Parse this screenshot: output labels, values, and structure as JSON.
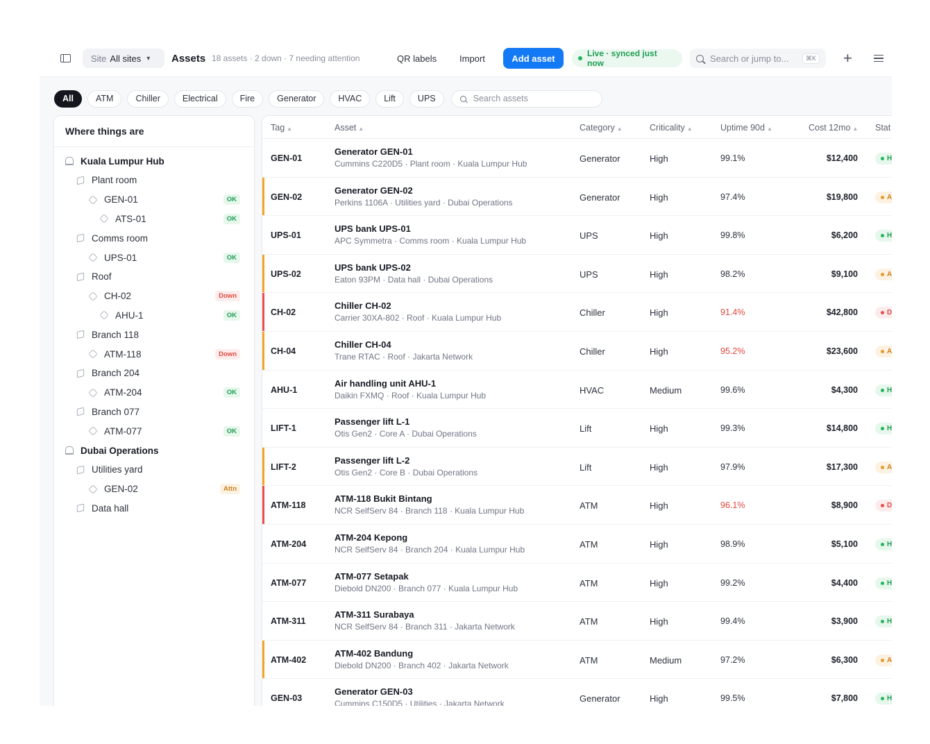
{
  "header": {
    "site_label": "Site",
    "site_value": "All sites",
    "title": "Assets",
    "subtitle": "18 assets · 2 down · 7 needing attention",
    "qr_labels": "QR labels",
    "import": "Import",
    "add_asset": "Add asset",
    "live_status": "Live · synced just now",
    "search_placeholder": "Search or jump to...",
    "search_shortcut": "⌘K"
  },
  "filters": {
    "chips": [
      "All",
      "ATM",
      "Chiller",
      "Electrical",
      "Fire",
      "Generator",
      "HVAC",
      "Lift",
      "UPS"
    ],
    "active": "All",
    "search_placeholder": "Search assets"
  },
  "tree": {
    "title": "Where things are",
    "nodes": [
      {
        "label": "Kuala Lumpur Hub",
        "level": 0,
        "kind": "site"
      },
      {
        "label": "Plant room",
        "level": 1,
        "kind": "room"
      },
      {
        "label": "GEN-01",
        "level": 2,
        "kind": "asset",
        "status": "OK"
      },
      {
        "label": "ATS-01",
        "level": 3,
        "kind": "asset",
        "status": "OK"
      },
      {
        "label": "Comms room",
        "level": 1,
        "kind": "room"
      },
      {
        "label": "UPS-01",
        "level": 2,
        "kind": "asset",
        "status": "OK"
      },
      {
        "label": "Roof",
        "level": 1,
        "kind": "room"
      },
      {
        "label": "CH-02",
        "level": 2,
        "kind": "asset",
        "status": "Down"
      },
      {
        "label": "AHU-1",
        "level": 3,
        "kind": "asset",
        "status": "OK"
      },
      {
        "label": "Branch 118",
        "level": 1,
        "kind": "room"
      },
      {
        "label": "ATM-118",
        "level": 2,
        "kind": "asset",
        "status": "Down"
      },
      {
        "label": "Branch 204",
        "level": 1,
        "kind": "room"
      },
      {
        "label": "ATM-204",
        "level": 2,
        "kind": "asset",
        "status": "OK"
      },
      {
        "label": "Branch 077",
        "level": 1,
        "kind": "room"
      },
      {
        "label": "ATM-077",
        "level": 2,
        "kind": "asset",
        "status": "OK"
      },
      {
        "label": "Dubai Operations",
        "level": 0,
        "kind": "site"
      },
      {
        "label": "Utilities yard",
        "level": 1,
        "kind": "room"
      },
      {
        "label": "GEN-02",
        "level": 2,
        "kind": "asset",
        "status": "Attn"
      },
      {
        "label": "Data hall",
        "level": 1,
        "kind": "room"
      }
    ]
  },
  "table": {
    "columns": [
      "Tag",
      "Asset",
      "Category",
      "Criticality",
      "Uptime 90d",
      "Cost 12mo",
      "Stat"
    ],
    "rows": [
      {
        "tag": "GEN-01",
        "name": "Generator GEN-01",
        "detail": "Cummins C220D5 · Plant room · Kuala Lumpur Hub",
        "category": "Generator",
        "criticality": "High",
        "uptime": "99.1%",
        "cost": "$12,400",
        "state": "ok",
        "status_text": "H"
      },
      {
        "tag": "GEN-02",
        "name": "Generator GEN-02",
        "detail": "Perkins 1106A · Utilities yard · Dubai Operations",
        "category": "Generator",
        "criticality": "High",
        "uptime": "97.4%",
        "cost": "$19,800",
        "state": "attn",
        "status_text": "A"
      },
      {
        "tag": "UPS-01",
        "name": "UPS bank UPS-01",
        "detail": "APC Symmetra · Comms room · Kuala Lumpur Hub",
        "category": "UPS",
        "criticality": "High",
        "uptime": "99.8%",
        "cost": "$6,200",
        "state": "ok",
        "status_text": "H"
      },
      {
        "tag": "UPS-02",
        "name": "UPS bank UPS-02",
        "detail": "Eaton 93PM · Data hall · Dubai Operations",
        "category": "UPS",
        "criticality": "High",
        "uptime": "98.2%",
        "cost": "$9,100",
        "state": "attn",
        "status_text": "A"
      },
      {
        "tag": "CH-02",
        "name": "Chiller CH-02",
        "detail": "Carrier 30XA-802 · Roof · Kuala Lumpur Hub",
        "category": "Chiller",
        "criticality": "High",
        "uptime": "91.4%",
        "cost": "$42,800",
        "state": "down",
        "status_text": "D"
      },
      {
        "tag": "CH-04",
        "name": "Chiller CH-04",
        "detail": "Trane RTAC · Roof · Jakarta Network",
        "category": "Chiller",
        "criticality": "High",
        "uptime": "95.2%",
        "cost": "$23,600",
        "state": "attn",
        "status_text": "A"
      },
      {
        "tag": "AHU-1",
        "name": "Air handling unit AHU-1",
        "detail": "Daikin FXMQ · Roof · Kuala Lumpur Hub",
        "category": "HVAC",
        "criticality": "Medium",
        "uptime": "99.6%",
        "cost": "$4,300",
        "state": "ok",
        "status_text": "H"
      },
      {
        "tag": "LIFT-1",
        "name": "Passenger lift L-1",
        "detail": "Otis Gen2 · Core A · Dubai Operations",
        "category": "Lift",
        "criticality": "High",
        "uptime": "99.3%",
        "cost": "$14,800",
        "state": "ok",
        "status_text": "H"
      },
      {
        "tag": "LIFT-2",
        "name": "Passenger lift L-2",
        "detail": "Otis Gen2 · Core B · Dubai Operations",
        "category": "Lift",
        "criticality": "High",
        "uptime": "97.9%",
        "cost": "$17,300",
        "state": "attn",
        "status_text": "A"
      },
      {
        "tag": "ATM-118",
        "name": "ATM-118 Bukit Bintang",
        "detail": "NCR SelfServ 84 · Branch 118 · Kuala Lumpur Hub",
        "category": "ATM",
        "criticality": "High",
        "uptime": "96.1%",
        "cost": "$8,900",
        "state": "down",
        "status_text": "D"
      },
      {
        "tag": "ATM-204",
        "name": "ATM-204 Kepong",
        "detail": "NCR SelfServ 84 · Branch 204 · Kuala Lumpur Hub",
        "category": "ATM",
        "criticality": "High",
        "uptime": "98.9%",
        "cost": "$5,100",
        "state": "ok",
        "status_text": "H"
      },
      {
        "tag": "ATM-077",
        "name": "ATM-077 Setapak",
        "detail": "Diebold DN200 · Branch 077 · Kuala Lumpur Hub",
        "category": "ATM",
        "criticality": "High",
        "uptime": "99.2%",
        "cost": "$4,400",
        "state": "ok",
        "status_text": "H"
      },
      {
        "tag": "ATM-311",
        "name": "ATM-311 Surabaya",
        "detail": "NCR SelfServ 84 · Branch 311 · Jakarta Network",
        "category": "ATM",
        "criticality": "High",
        "uptime": "99.4%",
        "cost": "$3,900",
        "state": "ok",
        "status_text": "H"
      },
      {
        "tag": "ATM-402",
        "name": "ATM-402 Bandung",
        "detail": "Diebold DN200 · Branch 402 · Jakarta Network",
        "category": "ATM",
        "criticality": "Medium",
        "uptime": "97.2%",
        "cost": "$6,300",
        "state": "attn",
        "status_text": "A"
      },
      {
        "tag": "GEN-03",
        "name": "Generator GEN-03",
        "detail": "Cummins C150D5 · Utilities · Jakarta Network",
        "category": "Generator",
        "criticality": "High",
        "uptime": "99.5%",
        "cost": "$7,800",
        "state": "ok",
        "status_text": "H"
      }
    ]
  },
  "colors": {
    "accent": "#1479f5",
    "ok": "#1f9d55",
    "attention": "#f5a524",
    "down": "#ee4b4b"
  },
  "icons": {
    "sidebar_toggle": "sidebar-toggle-icon",
    "search": "search-icon",
    "plus": "plus-icon",
    "menu": "hamburger-menu-icon",
    "site": "building-icon",
    "room": "room-icon",
    "asset": "cube-icon"
  }
}
